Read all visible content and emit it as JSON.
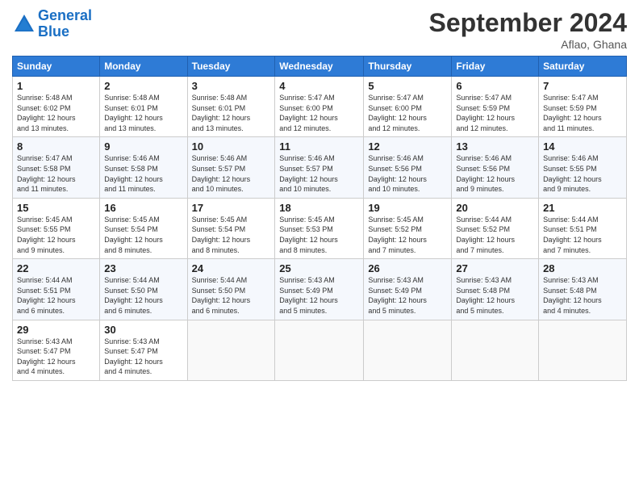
{
  "logo": {
    "line1": "General",
    "line2": "Blue"
  },
  "title": "September 2024",
  "location": "Aflao, Ghana",
  "weekdays": [
    "Sunday",
    "Monday",
    "Tuesday",
    "Wednesday",
    "Thursday",
    "Friday",
    "Saturday"
  ],
  "weeks": [
    [
      {
        "day": "1",
        "info": "Sunrise: 5:48 AM\nSunset: 6:02 PM\nDaylight: 12 hours\nand 13 minutes."
      },
      {
        "day": "2",
        "info": "Sunrise: 5:48 AM\nSunset: 6:01 PM\nDaylight: 12 hours\nand 13 minutes."
      },
      {
        "day": "3",
        "info": "Sunrise: 5:48 AM\nSunset: 6:01 PM\nDaylight: 12 hours\nand 13 minutes."
      },
      {
        "day": "4",
        "info": "Sunrise: 5:47 AM\nSunset: 6:00 PM\nDaylight: 12 hours\nand 12 minutes."
      },
      {
        "day": "5",
        "info": "Sunrise: 5:47 AM\nSunset: 6:00 PM\nDaylight: 12 hours\nand 12 minutes."
      },
      {
        "day": "6",
        "info": "Sunrise: 5:47 AM\nSunset: 5:59 PM\nDaylight: 12 hours\nand 12 minutes."
      },
      {
        "day": "7",
        "info": "Sunrise: 5:47 AM\nSunset: 5:59 PM\nDaylight: 12 hours\nand 11 minutes."
      }
    ],
    [
      {
        "day": "8",
        "info": "Sunrise: 5:47 AM\nSunset: 5:58 PM\nDaylight: 12 hours\nand 11 minutes."
      },
      {
        "day": "9",
        "info": "Sunrise: 5:46 AM\nSunset: 5:58 PM\nDaylight: 12 hours\nand 11 minutes."
      },
      {
        "day": "10",
        "info": "Sunrise: 5:46 AM\nSunset: 5:57 PM\nDaylight: 12 hours\nand 10 minutes."
      },
      {
        "day": "11",
        "info": "Sunrise: 5:46 AM\nSunset: 5:57 PM\nDaylight: 12 hours\nand 10 minutes."
      },
      {
        "day": "12",
        "info": "Sunrise: 5:46 AM\nSunset: 5:56 PM\nDaylight: 12 hours\nand 10 minutes."
      },
      {
        "day": "13",
        "info": "Sunrise: 5:46 AM\nSunset: 5:56 PM\nDaylight: 12 hours\nand 9 minutes."
      },
      {
        "day": "14",
        "info": "Sunrise: 5:46 AM\nSunset: 5:55 PM\nDaylight: 12 hours\nand 9 minutes."
      }
    ],
    [
      {
        "day": "15",
        "info": "Sunrise: 5:45 AM\nSunset: 5:55 PM\nDaylight: 12 hours\nand 9 minutes."
      },
      {
        "day": "16",
        "info": "Sunrise: 5:45 AM\nSunset: 5:54 PM\nDaylight: 12 hours\nand 8 minutes."
      },
      {
        "day": "17",
        "info": "Sunrise: 5:45 AM\nSunset: 5:54 PM\nDaylight: 12 hours\nand 8 minutes."
      },
      {
        "day": "18",
        "info": "Sunrise: 5:45 AM\nSunset: 5:53 PM\nDaylight: 12 hours\nand 8 minutes."
      },
      {
        "day": "19",
        "info": "Sunrise: 5:45 AM\nSunset: 5:52 PM\nDaylight: 12 hours\nand 7 minutes."
      },
      {
        "day": "20",
        "info": "Sunrise: 5:44 AM\nSunset: 5:52 PM\nDaylight: 12 hours\nand 7 minutes."
      },
      {
        "day": "21",
        "info": "Sunrise: 5:44 AM\nSunset: 5:51 PM\nDaylight: 12 hours\nand 7 minutes."
      }
    ],
    [
      {
        "day": "22",
        "info": "Sunrise: 5:44 AM\nSunset: 5:51 PM\nDaylight: 12 hours\nand 6 minutes."
      },
      {
        "day": "23",
        "info": "Sunrise: 5:44 AM\nSunset: 5:50 PM\nDaylight: 12 hours\nand 6 minutes."
      },
      {
        "day": "24",
        "info": "Sunrise: 5:44 AM\nSunset: 5:50 PM\nDaylight: 12 hours\nand 6 minutes."
      },
      {
        "day": "25",
        "info": "Sunrise: 5:43 AM\nSunset: 5:49 PM\nDaylight: 12 hours\nand 5 minutes."
      },
      {
        "day": "26",
        "info": "Sunrise: 5:43 AM\nSunset: 5:49 PM\nDaylight: 12 hours\nand 5 minutes."
      },
      {
        "day": "27",
        "info": "Sunrise: 5:43 AM\nSunset: 5:48 PM\nDaylight: 12 hours\nand 5 minutes."
      },
      {
        "day": "28",
        "info": "Sunrise: 5:43 AM\nSunset: 5:48 PM\nDaylight: 12 hours\nand 4 minutes."
      }
    ],
    [
      {
        "day": "29",
        "info": "Sunrise: 5:43 AM\nSunset: 5:47 PM\nDaylight: 12 hours\nand 4 minutes."
      },
      {
        "day": "30",
        "info": "Sunrise: 5:43 AM\nSunset: 5:47 PM\nDaylight: 12 hours\nand 4 minutes."
      },
      {
        "day": "",
        "info": ""
      },
      {
        "day": "",
        "info": ""
      },
      {
        "day": "",
        "info": ""
      },
      {
        "day": "",
        "info": ""
      },
      {
        "day": "",
        "info": ""
      }
    ]
  ]
}
